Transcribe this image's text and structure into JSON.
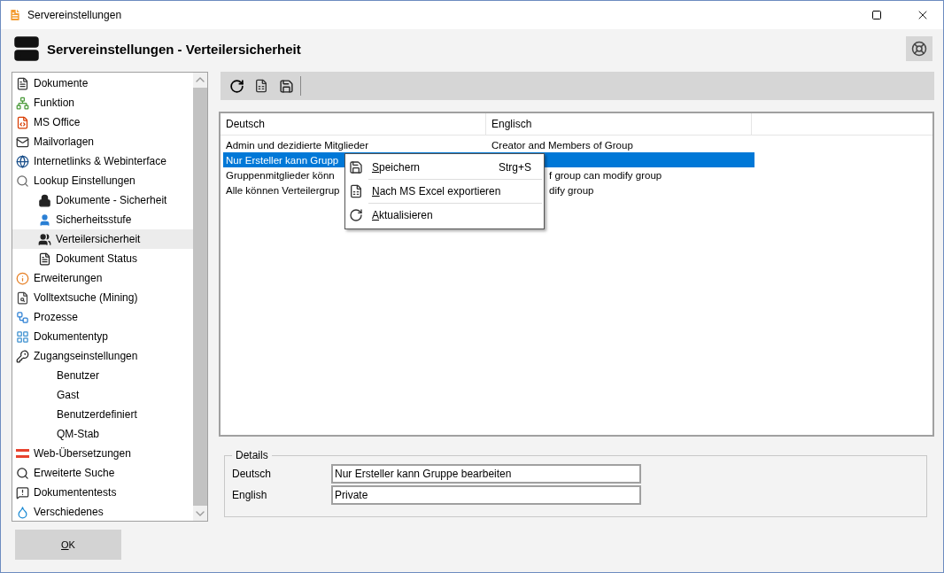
{
  "window": {
    "title": "Servereinstellungen"
  },
  "header": {
    "title": "Servereinstellungen - Verteilersicherheit"
  },
  "sidebar": {
    "items": [
      {
        "label": "Dokumente",
        "selected": false
      },
      {
        "label": "Funktion",
        "selected": false
      },
      {
        "label": "MS Office",
        "selected": false
      },
      {
        "label": "Mailvorlagen",
        "selected": false
      },
      {
        "label": "Internetlinks & Webinterface",
        "selected": false
      },
      {
        "label": "Lookup Einstellungen",
        "selected": false,
        "children": [
          {
            "label": "Dokumente - Sicherheit",
            "selected": false
          },
          {
            "label": "Sicherheitsstufe",
            "selected": false
          },
          {
            "label": "Verteilersicherheit",
            "selected": true
          },
          {
            "label": "Dokument Status",
            "selected": false
          }
        ]
      },
      {
        "label": "Erweiterungen",
        "selected": false
      },
      {
        "label": "Volltextsuche (Mining)",
        "selected": false
      },
      {
        "label": "Prozesse",
        "selected": false
      },
      {
        "label": "Dokumententyp",
        "selected": false
      },
      {
        "label": "Zugangseinstellungen",
        "selected": false,
        "children": [
          {
            "label": "Benutzer",
            "selected": false
          },
          {
            "label": "Gast",
            "selected": false
          },
          {
            "label": "Benutzerdefiniert",
            "selected": false
          },
          {
            "label": "QM-Stab",
            "selected": false
          }
        ]
      },
      {
        "label": "Web-Übersetzungen",
        "selected": false
      },
      {
        "label": "Erweiterte Suche",
        "selected": false
      },
      {
        "label": "Dokumententests",
        "selected": false
      },
      {
        "label": "Verschiedenes",
        "selected": false
      }
    ]
  },
  "table": {
    "columns": [
      "Deutsch",
      "Englisch"
    ],
    "rows": [
      {
        "selected": false,
        "cells": [
          {
            "text": "Admin und dezidierte Mitglieder"
          },
          {
            "text": "Creator and Members of Group"
          }
        ]
      },
      {
        "selected": true,
        "cells": [
          {
            "text": "Nur Ersteller kann Grupp"
          }
        ]
      },
      {
        "selected": false,
        "cells": [
          {
            "text": "Gruppenmitglieder könn"
          },
          {
            "text": "f group can modify group",
            "cut": true
          }
        ]
      },
      {
        "selected": false,
        "cells": [
          {
            "text": "Alle können Verteilergrup"
          },
          {
            "text": "dify group",
            "cut": true
          }
        ]
      }
    ]
  },
  "context_menu": {
    "items": [
      {
        "label": "Speichern",
        "shortcut": "Strg+S"
      },
      {
        "label": "Nach MS Excel exportieren"
      },
      {
        "label": "Aktualisieren"
      }
    ]
  },
  "details": {
    "title": "Details",
    "fields": [
      {
        "label": "Deutsch",
        "value": "Nur Ersteller kann Gruppe bearbeiten"
      },
      {
        "label": "English",
        "value": "Private"
      }
    ]
  },
  "buttons": [
    {
      "label": "OK"
    }
  ]
}
